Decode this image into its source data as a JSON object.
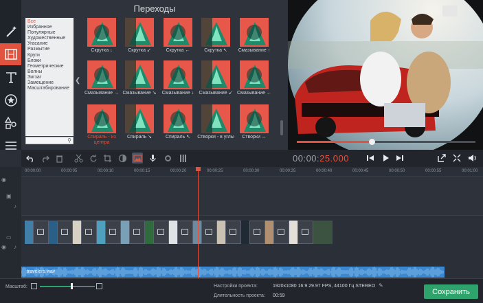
{
  "panel": {
    "title": "Переходы"
  },
  "categories": [
    {
      "label": "Все",
      "selected": true
    },
    {
      "label": "Избранное"
    },
    {
      "label": "Популярные"
    },
    {
      "label": "Художественные"
    },
    {
      "label": "Угасание"
    },
    {
      "label": "Размытие"
    },
    {
      "label": "Круги"
    },
    {
      "label": "Блоки"
    },
    {
      "label": "Геометрические"
    },
    {
      "label": "Волны"
    },
    {
      "label": "Зигзаг"
    },
    {
      "label": "Замещение"
    },
    {
      "label": "Масштабирование"
    }
  ],
  "transitions": [
    "Скрутка ↓",
    "Скрутка ↙",
    "Скрутка ←",
    "Скрутка ↖",
    "Смазывание ↑",
    "Смазывание →",
    "Смазывание ↘",
    "Смазывание ↓",
    "Смазывание ↙",
    "Смазывание ←",
    "Спираль - из центра",
    "Спираль ↘",
    "Спираль ↖",
    "Створки - в углы",
    "Створки ↔"
  ],
  "player": {
    "timecode_dim": "00:00:",
    "timecode_hot": "25.000",
    "progress": 0.42
  },
  "ruler": [
    "00:00:00",
    "00:00:05",
    "00:00:10",
    "00:00:15",
    "00:00:20",
    "00:00:25",
    "00:00:30",
    "00:00:35",
    "00:00:40",
    "00:00:45",
    "00:00:50",
    "00:00:55",
    "00:01:00"
  ],
  "audio": {
    "file": "travelers.wav"
  },
  "status": {
    "scale_label": "Масштаб:",
    "zoom_level": 0.58,
    "settings_label": "Настройки проекта:",
    "settings_value": "1920x1080 16:9 29.97 FPS, 44100 Гц STEREO",
    "duration_label": "Длительность проекта:",
    "duration_value": "00:59",
    "save_label": "Сохранить"
  },
  "colors": {
    "accent": "#e2533f",
    "save": "#2ea36b",
    "audio": "#3b88d0"
  }
}
